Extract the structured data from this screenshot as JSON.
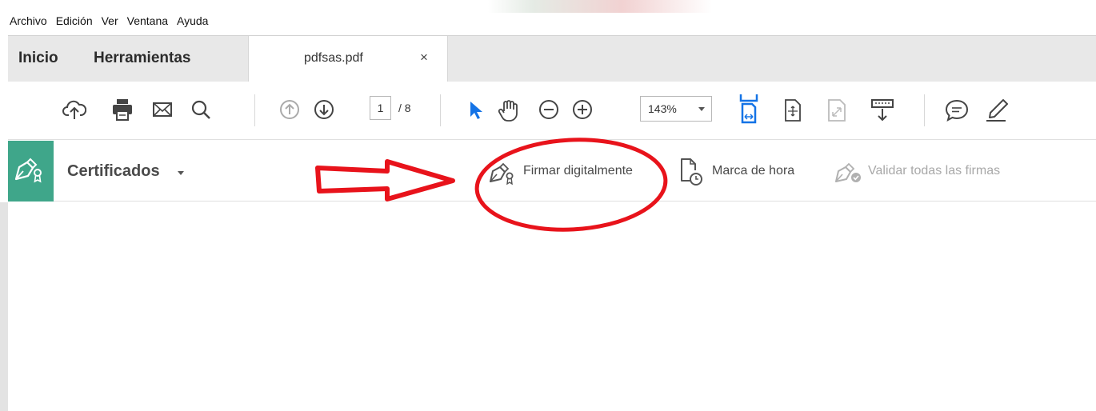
{
  "menu": {
    "items": [
      {
        "label": "Archivo"
      },
      {
        "label": "Edición"
      },
      {
        "label": "Ver"
      },
      {
        "label": "Ventana"
      },
      {
        "label": "Ayuda"
      }
    ]
  },
  "tabs": {
    "home": "Inicio",
    "tools": "Herramientas",
    "document": "pdfsas.pdf",
    "close_glyph": "×"
  },
  "toolbar": {
    "icons": [
      "upload-cloud-icon",
      "print-icon",
      "email-icon",
      "search-icon",
      "prev-page-icon",
      "next-page-icon",
      "select-cursor-icon",
      "hand-tool-icon",
      "zoom-out-icon",
      "zoom-in-icon",
      "fit-width-icon",
      "fit-page-icon",
      "full-screen-icon",
      "read-mode-icon",
      "comment-icon",
      "highlight-pen-icon"
    ],
    "page_current": "1",
    "page_total": "/ 8",
    "zoom": "143%"
  },
  "certificates": {
    "title": "Certificados",
    "actions": {
      "sign": "Firmar digitalmente",
      "timestamp": "Marca de hora",
      "validate": "Validar todas las firmas"
    }
  },
  "colors": {
    "accent_green": "#3fa68a",
    "select_blue": "#1473e6",
    "annotation_red": "#e8131b"
  }
}
